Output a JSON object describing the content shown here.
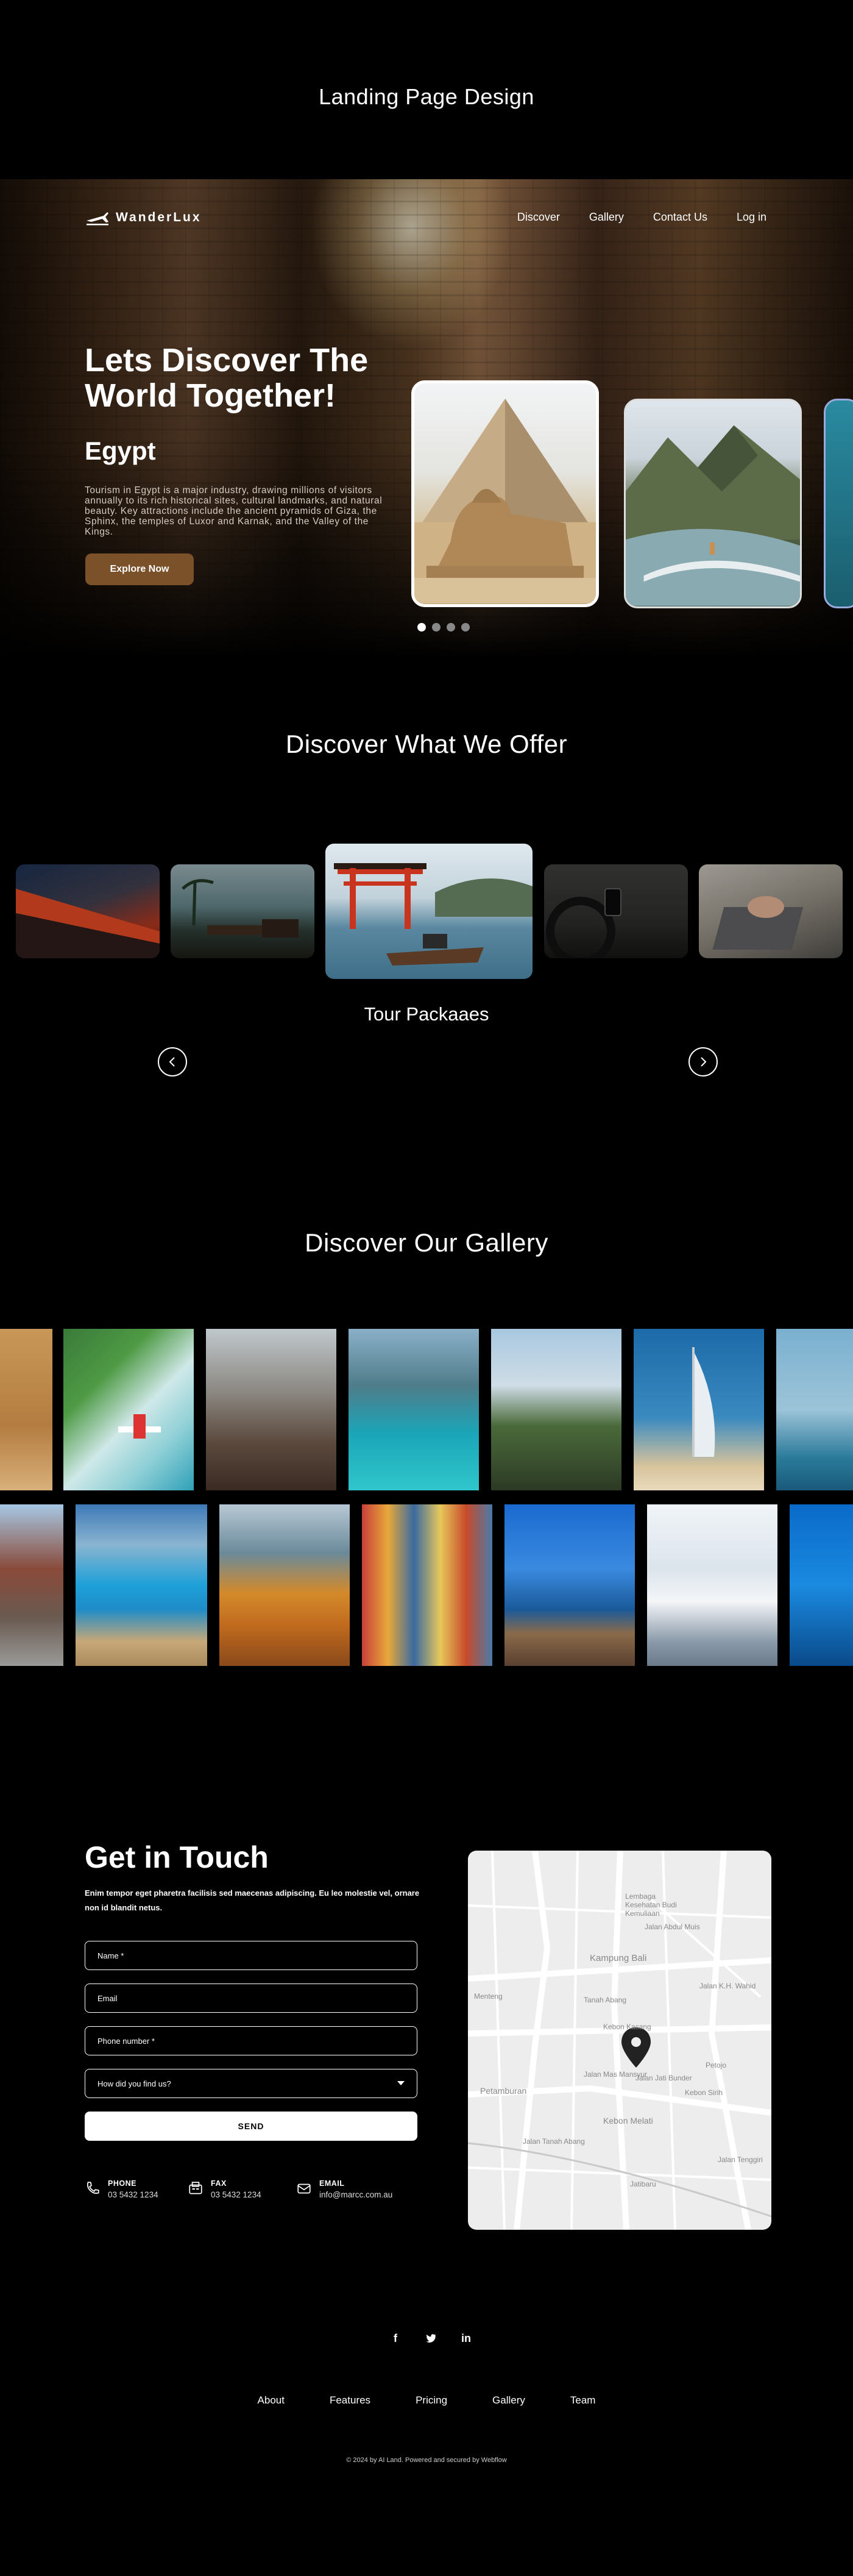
{
  "page": {
    "title": "Landing Page Design"
  },
  "brand": {
    "name": "WanderLux"
  },
  "nav": {
    "items": [
      "Discover",
      "Gallery",
      "Contact Us",
      "Log in"
    ]
  },
  "hero": {
    "headline": "Lets Discover The World Together!",
    "place": "Egypt",
    "description": "Tourism in Egypt is a major industry, drawing millions of visitors annually to its rich historical sites, cultural landmarks, and natural beauty. Key attractions include the ancient pyramids of Giza, the Sphinx, the temples of Luxor and Karnak, and the Valley of the Kings.",
    "cta": "Explore Now",
    "slider": {
      "total": 4,
      "active": 1
    }
  },
  "offer": {
    "title": "Discover What We Offer",
    "active_label": "Tour Packaaes"
  },
  "gallery": {
    "title": "Discover Our Gallery"
  },
  "contact": {
    "title": "Get in Touch",
    "subtitle": "Enim tempor eget pharetra facilisis sed maecenas adipiscing. Eu leo molestie vel, ornare non id blandit netus.",
    "fields": {
      "name": "Name *",
      "email": "Email",
      "phone": "Phone number *",
      "source": "How did you find us?"
    },
    "send": "SEND",
    "info": [
      {
        "label": "PHONE",
        "value": "03 5432 1234",
        "icon": "phone-icon"
      },
      {
        "label": "FAX",
        "value": "03 5432 1234",
        "icon": "fax-icon"
      },
      {
        "label": "EMAIL",
        "value": "info@marcc.com.au",
        "icon": "mail-icon"
      }
    ]
  },
  "map": {
    "labels": [
      "Lembaga Kesehatan Budi Kemuliaan",
      "Jalan Abdul Muis",
      "Kampung Bali",
      "Jalan K.H. Wahid",
      "Tanah Abang",
      "Kebon Kacang",
      "Jalan Mas Mansyur",
      "Petamburan",
      "Petojo",
      "Kebon Melati",
      "Jalan Jati Bunder",
      "Kebon Sirih",
      "Menteng",
      "Jatibaru",
      "Jalan Tenggiri",
      "Jalan Tanah Abang"
    ]
  },
  "footer": {
    "social": [
      "f",
      "t",
      "in"
    ],
    "nav": [
      "About",
      "Features",
      "Pricing",
      "Gallery",
      "Team"
    ],
    "copyright": "© 2024 by AI Land. Powered and secured by Webflow"
  },
  "colors": {
    "accent": "#7a5129",
    "background": "#000000"
  }
}
